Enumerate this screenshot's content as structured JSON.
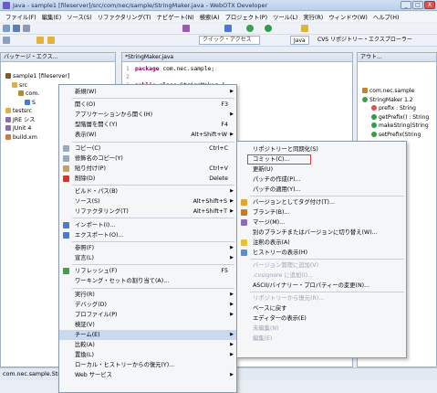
{
  "window": {
    "title": "Java - sample1  [fileserver]/src/com/nec/sample/StringMaker.java - WebOTX Developer",
    "buttons": [
      "_",
      "□",
      "X"
    ]
  },
  "menubar": [
    "ファイル(F)",
    "編集(E)",
    "ソース(S)",
    "リファクタリング(T)",
    "ナビゲート(N)",
    "検索(A)",
    "プロジェクト(P)",
    "ツール(L)",
    "実行(R)",
    "ウィンドウ(W)",
    "ヘルプ(H)"
  ],
  "toolbar": {
    "quick_access": "クイック・アクセス",
    "perspectives": [
      "Java",
      "CVS リポジトリー・エクスプローラー"
    ]
  },
  "left_panel": {
    "tab": "パッケージ・エクス...",
    "tree": [
      {
        "label": "sample1  [fileserver]",
        "indent": 1,
        "icon": "project-icon"
      },
      {
        "label": "src",
        "indent": 2,
        "icon": "folder-icon"
      },
      {
        "label": "com.",
        "indent": 3,
        "icon": "package-icon"
      },
      {
        "label": "S",
        "indent": 4,
        "icon": "java-file-icon"
      },
      {
        "label": "testsrc",
        "indent": 1,
        "icon": "folder-icon"
      },
      {
        "label": "JRE シス",
        "indent": 1,
        "icon": "library-icon"
      },
      {
        "label": "JUnit 4",
        "indent": 1,
        "icon": "library-icon"
      },
      {
        "label": "build.xm",
        "indent": 1,
        "icon": "xml-file-icon"
      }
    ]
  },
  "editor": {
    "tab": "*StringMaker.java",
    "lines": [
      {
        "num": "1",
        "kw": "package",
        "rest": " com.nec.sample;"
      },
      {
        "num": "2",
        "kw": "",
        "rest": ""
      },
      {
        "num": "3",
        "kw": "public class",
        "rest": " StringMaker {"
      }
    ]
  },
  "right_panel": {
    "tab": "アウト...",
    "items": [
      {
        "label": "com.nec.sample",
        "icon": "package-icon"
      },
      {
        "label": "StringMaker  1.2",
        "icon": "class-icon"
      },
      {
        "label": "prefix : String",
        "icon": "field-icon"
      },
      {
        "label": "getPrefix() : String",
        "icon": "method-icon"
      },
      {
        "label": "makeString(String",
        "icon": "method-icon"
      },
      {
        "label": "setPrefix(String",
        "icon": "method-icon"
      }
    ]
  },
  "statusbar": {
    "text": "com.nec.sample.StringMaker"
  },
  "context_menu": {
    "items": [
      {
        "label": "新規(W)",
        "arrow": true
      },
      {
        "sep": true
      },
      {
        "label": "開く(O)",
        "acc": "F3"
      },
      {
        "label": "アプリケーションから開く(H)",
        "arrow": true
      },
      {
        "label": "型階層を開く(Y)",
        "acc": "F4"
      },
      {
        "label": "表示(W)",
        "acc": "Alt+Shift+W",
        "arrow": true
      },
      {
        "sep": true
      },
      {
        "label": "コピー(C)",
        "acc": "Ctrl+C",
        "icon": "copy-icon"
      },
      {
        "label": "修飾名のコピー(Y)",
        "icon": "copy-icon"
      },
      {
        "label": "貼り付け(P)",
        "acc": "Ctrl+V",
        "icon": "paste-icon"
      },
      {
        "label": "削除(D)",
        "acc": "Delete",
        "icon": "delete-icon"
      },
      {
        "sep": true
      },
      {
        "label": "ビルド・パス(B)",
        "arrow": true
      },
      {
        "label": "ソース(S)",
        "acc": "Alt+Shift+S",
        "arrow": true
      },
      {
        "label": "リファクタリング(T)",
        "acc": "Alt+Shift+T",
        "arrow": true
      },
      {
        "sep": true
      },
      {
        "label": "インポート(I)...",
        "icon": "import-icon"
      },
      {
        "label": "エクスポート(O)...",
        "icon": "export-icon"
      },
      {
        "sep": true
      },
      {
        "label": "参照(F)",
        "arrow": true
      },
      {
        "label": "宣言(L)",
        "arrow": true
      },
      {
        "sep": true
      },
      {
        "label": "リフレッシュ(F)",
        "acc": "F5",
        "icon": "refresh-icon"
      },
      {
        "label": "ワーキング・セットの割り当て(A)..."
      },
      {
        "sep": true
      },
      {
        "label": "実行(R)",
        "arrow": true
      },
      {
        "label": "デバッグ(D)",
        "arrow": true
      },
      {
        "label": "プロファイル(P)",
        "arrow": true
      },
      {
        "label": "検証(V)"
      },
      {
        "label": "チーム(E)",
        "arrow": true,
        "hl": true
      },
      {
        "label": "比較(A)",
        "arrow": true
      },
      {
        "label": "置換(L)",
        "arrow": true
      },
      {
        "label": "ローカル・ヒストリーからの復元(Y)..."
      },
      {
        "label": "Web サービス",
        "arrow": true
      }
    ]
  },
  "submenu": {
    "items": [
      {
        "label": "リポジトリーと同期化(S)"
      },
      {
        "label": "コミット(C)...",
        "boxed": true
      },
      {
        "label": "更新(U)"
      },
      {
        "label": "パッチの作成(P)..."
      },
      {
        "label": "パッチの適用(Y)..."
      },
      {
        "sep": true
      },
      {
        "label": "バージョンとしてタグ付け(T)...",
        "icon": "tag-icon"
      },
      {
        "label": "ブランチ(B)...",
        "icon": "branch-icon"
      },
      {
        "label": "マージ(M)...",
        "icon": "merge-icon"
      },
      {
        "label": "別のブランチまたはバージョンに切り替え(W)..."
      },
      {
        "label": "注釈の表示(A)",
        "icon": "annotate-icon"
      },
      {
        "label": "ヒストリーの表示(H)",
        "icon": "history-icon"
      },
      {
        "sep": true
      },
      {
        "label": "バージョン管理に追加(V)",
        "dis": true
      },
      {
        "label": ".cvsignore に追加(I)...",
        "dis": true
      },
      {
        "label": "ASCII/バイナリー・プロパティーの変更(N)..."
      },
      {
        "sep": true
      },
      {
        "label": "リポジトリーから復元(R)...",
        "dis": true
      },
      {
        "label": "ベースに戻す"
      },
      {
        "label": "エディターの表示(E)"
      },
      {
        "label": "未編集(N)",
        "dis": true
      },
      {
        "label": "編集(E)",
        "dis": true
      }
    ]
  },
  "colors": {
    "highlight": "#c8d9f0",
    "commit_box": "#e53935"
  }
}
